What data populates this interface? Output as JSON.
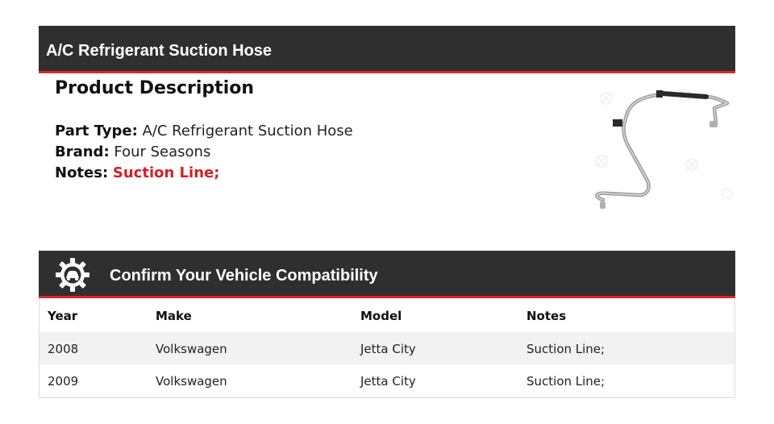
{
  "header": {
    "title": "A/C Refrigerant Suction Hose"
  },
  "description": {
    "heading": "Product Description",
    "fields": [
      {
        "label": "Part Type:",
        "value": "A/C Refrigerant Suction Hose"
      },
      {
        "label": "Brand:",
        "value": "Four Seasons"
      },
      {
        "label": "Notes:",
        "value": "Suction Line;"
      }
    ]
  },
  "product_image": {
    "icon": "ac-suction-hose-image"
  },
  "compat": {
    "title": "Confirm Your Vehicle Compatibility",
    "icon": "gear-car-icon",
    "columns": [
      "Year",
      "Make",
      "Model",
      "Notes"
    ],
    "rows": [
      {
        "year": "2008",
        "make": "Volkswagen",
        "model": "Jetta City",
        "notes": "Suction Line;"
      },
      {
        "year": "2009",
        "make": "Volkswagen",
        "model": "Jetta City",
        "notes": "Suction Line;"
      }
    ]
  },
  "colors": {
    "bar": "#2f2f2f",
    "accent": "#e0242b",
    "note": "#d42026"
  }
}
